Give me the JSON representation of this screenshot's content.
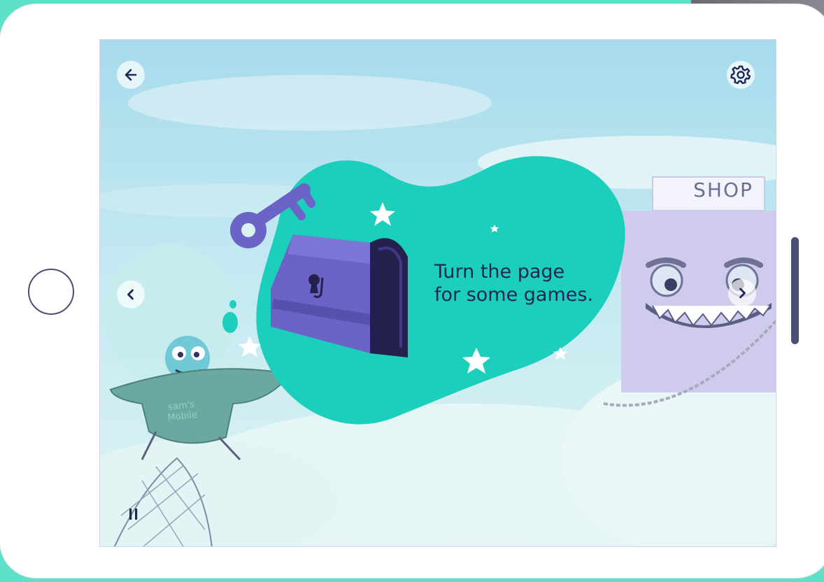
{
  "screen": {
    "message_line1": "Turn the page",
    "message_line2": "for some games.",
    "shop_sign": "SHOP",
    "hat_text_line1": "sam's",
    "hat_text_line2": "Mobile"
  },
  "icons": {
    "back": "arrow-left-icon",
    "settings": "gear-icon",
    "prev_page": "chevron-left-icon",
    "next_page": "chevron-right-icon",
    "pause": "pause-icon",
    "home": "home-button",
    "key": "key-icon",
    "chest": "treasure-chest-icon"
  },
  "colors": {
    "frame_bg": "#5fe0c9",
    "bubble": "#1ccfbc",
    "text_dark": "#202655",
    "chest_purple": "#6b63c6",
    "chest_dark": "#24214f",
    "sky": "#b8e2ef"
  }
}
